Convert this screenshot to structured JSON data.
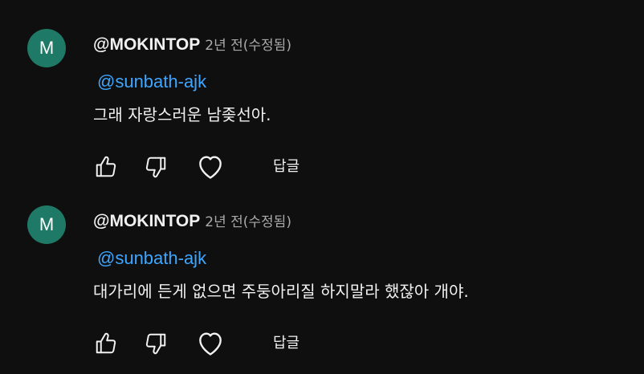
{
  "comments": [
    {
      "avatar_letter": "M",
      "author": "@MOKINTOP",
      "time": "2년 전(수정됨)",
      "mention": "@sunbath-ajk",
      "text": "그래 자랑스러운 남좆선아.",
      "reply_label": "답글",
      "icons": [
        "thumbs-up-icon",
        "thumbs-down-icon",
        "heart-icon"
      ]
    },
    {
      "avatar_letter": "M",
      "author": "@MOKINTOP",
      "time": "2년 전(수정됨)",
      "mention": "@sunbath-ajk",
      "text": "대가리에 든게 없으면 주둥아리질 하지말라 했잖아 개야.",
      "reply_label": "답글",
      "icons": [
        "thumbs-up-icon",
        "thumbs-down-icon",
        "heart-icon"
      ]
    }
  ],
  "colors": {
    "background": "#0f0f0f",
    "avatar": "#1e7a66",
    "mention": "#3ea6ff",
    "secondary_text": "#aaaaaa"
  }
}
